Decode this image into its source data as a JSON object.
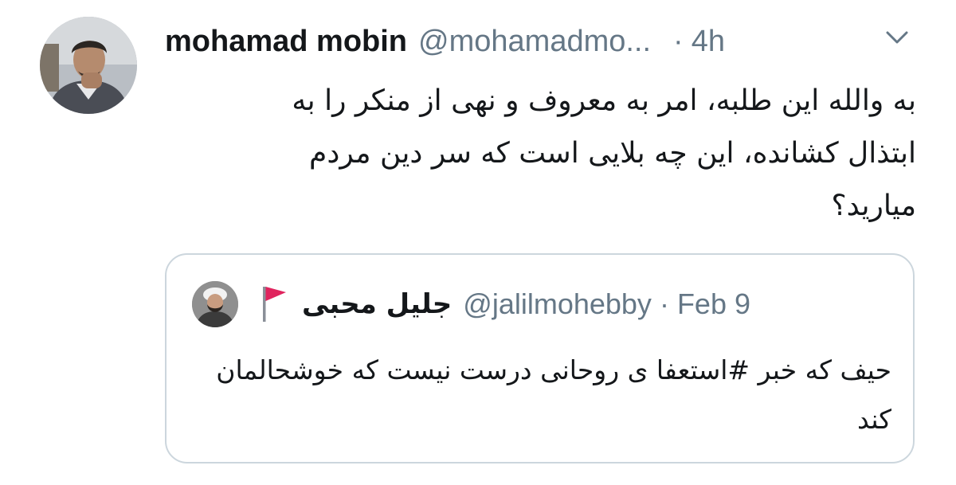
{
  "tweet": {
    "author_name": "mohamad mobin",
    "author_handle": "@mohamadmo...",
    "separator": "·",
    "timestamp": "4h",
    "text": "به والله این طلبه، امر به معروف و نهی از منکر را به ابتذال کشانده، این چه بلایی است که سر دین مردم میارید؟",
    "avatar_icon": "user-avatar-photo",
    "menu_icon": "chevron-down-icon"
  },
  "quoted_tweet": {
    "author_name": "جلیل محبی",
    "author_handle": "@jalilmohebby",
    "separator": "·",
    "timestamp": "Feb 9",
    "text": "حیف که خبر #استعفا ی روحانی درست نیست که خوشحالمان کند",
    "avatar_icon": "cleric-avatar-photo",
    "flag_icon": "red-flag-icon",
    "flag_color": "#e0245e"
  },
  "colors": {
    "text_primary": "#14171a",
    "text_secondary": "#657786",
    "border": "#ccd6dd"
  }
}
